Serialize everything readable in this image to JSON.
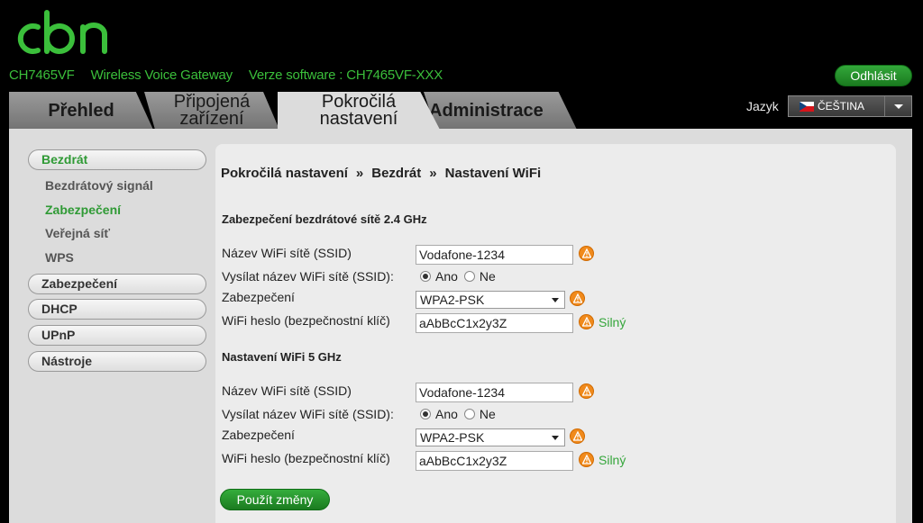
{
  "brand": {
    "logo_text": "cbn",
    "logo_color": "#3bbf3b",
    "logo_icon": "cbn-logo"
  },
  "header": {
    "model": "CH7465VF",
    "product": "Wireless Voice Gateway",
    "software": "Verze software : CH7465VF-XXX",
    "logout_label": "Odhlásit"
  },
  "tabs": [
    {
      "label": "Přehled",
      "active": false
    },
    {
      "label_line1": "Připojená",
      "label_line2": "zařízení",
      "active": false
    },
    {
      "label_line1": "Pokročilá",
      "label_line2": "nastavení",
      "active": true
    },
    {
      "label": "Administrace",
      "active": false
    }
  ],
  "language": {
    "label": "Jazyk",
    "selected": "ČEŠTINA",
    "flag_icon": "czech-flag-icon"
  },
  "sidebar": {
    "sections": [
      {
        "label": "Bezdrát",
        "active": true
      },
      {
        "label": "Zabezpečení"
      },
      {
        "label": "DHCP"
      },
      {
        "label": "UPnP"
      },
      {
        "label": "Nástroje"
      }
    ],
    "subitems": [
      {
        "label": "Bezdrátový signál",
        "active": false
      },
      {
        "label": "Zabezpečení",
        "active": true
      },
      {
        "label": "Veřejná síť",
        "active": false
      },
      {
        "label": "WPS",
        "active": false
      }
    ]
  },
  "breadcrumb": [
    "Pokročilá nastavení",
    "Bezdrát",
    "Nastavení WiFi"
  ],
  "breadcrumb_sep": "»",
  "band24": {
    "title": "Zabezpečení bezdrátové sítě 2.4 GHz",
    "ssid_label": "Název WiFi sítě (SSID)",
    "ssid_value": "Vodafone-1234",
    "broadcast_label": "Vysílat název WiFi sítě (SSID):",
    "yes": "Ano",
    "no": "Ne",
    "broadcast_selected": "Ano",
    "security_label": "Zabezpečení",
    "security_value": "WPA2-PSK",
    "password_label": "WiFi heslo (bezpečnostní klíč)",
    "password_value": "aAbBcC1x2y3Z",
    "strength": "Silný"
  },
  "band5": {
    "title": "Nastavení WiFi 5 GHz",
    "ssid_label": "Název WiFi sítě (SSID)",
    "ssid_value": "Vodafone-1234",
    "broadcast_label": "Vysílat název WiFi sítě (SSID):",
    "yes": "Ano",
    "no": "Ne",
    "broadcast_selected": "Ano",
    "security_label": "Zabezpečení",
    "security_value": "WPA2-PSK",
    "password_label": "WiFi heslo (bezpečnostní klíč)",
    "password_value": "aAbBcC1x2y3Z",
    "strength": "Silný"
  },
  "apply_label": "Použít změny",
  "colors": {
    "accent_green": "#3bbf3b",
    "warning_orange": "#f08a1c",
    "panel_gray": "#dcdcdc"
  }
}
